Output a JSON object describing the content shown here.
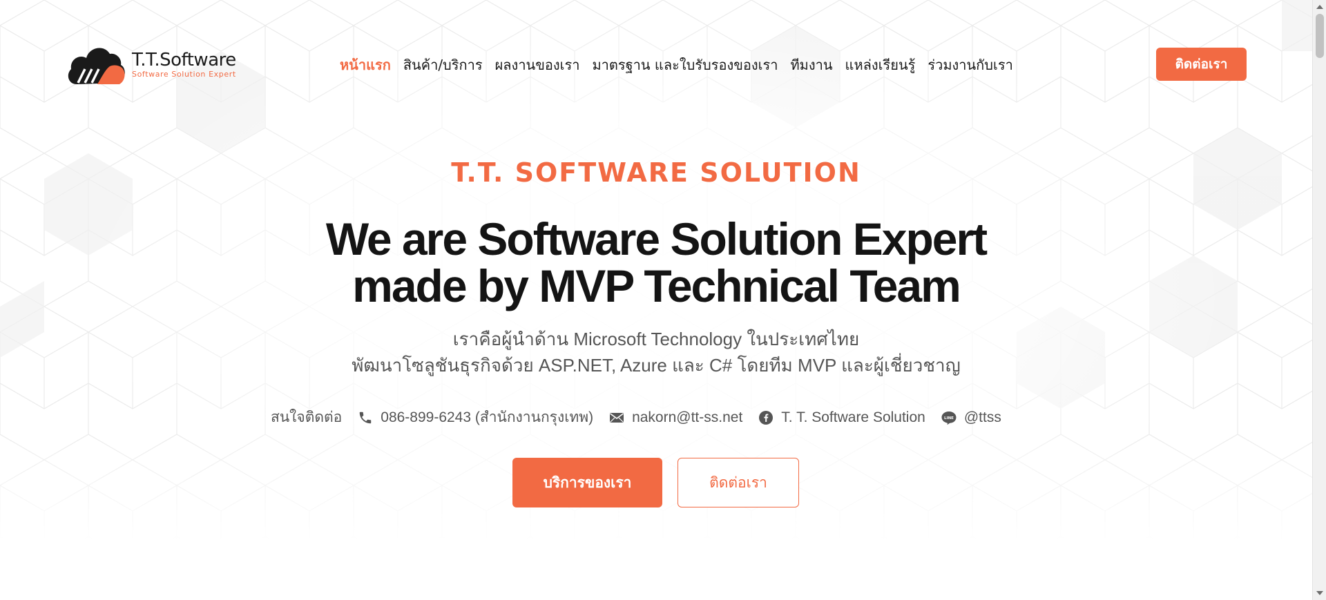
{
  "logo": {
    "name": "T.T.Software",
    "tagline": "Software Solution Expert"
  },
  "nav": {
    "items": [
      {
        "label": "หน้าแรก",
        "active": true
      },
      {
        "label": "สินค้า/บริการ",
        "active": false
      },
      {
        "label": "ผลงานของเรา",
        "active": false
      },
      {
        "label": "มาตรฐาน และใบรับรองของเรา",
        "active": false
      },
      {
        "label": "ทีมงาน",
        "active": false
      },
      {
        "label": "แหล่งเรียนรู้",
        "active": false
      },
      {
        "label": "ร่วมงานกับเรา",
        "active": false
      }
    ],
    "contact_button": "ติดต่อเรา"
  },
  "hero": {
    "eyebrow": "T.T. SOFTWARE SOLUTION",
    "headline_line1": "We are Software Solution Expert",
    "headline_line2": "made by MVP Technical Team",
    "sub_line1": "เราคือผู้นำด้าน Microsoft Technology ในประเทศไทย",
    "sub_line2": "พัฒนาโซลูชันธุรกิจด้วย ASP.NET, Azure และ C# โดยทีม MVP และผู้เชี่ยวชาญ",
    "contacts": {
      "label": "สนใจติดต่อ",
      "phone": "086-899-6243 (สำนักงานกรุงเทพ)",
      "email": "nakorn@tt-ss.net",
      "facebook": "T. T. Software Solution",
      "line": "@ttss"
    },
    "primary_button": "บริการของเรา",
    "secondary_button": "ติดต่อเรา"
  },
  "icons": {
    "phone": "phone-icon",
    "email": "email-icon",
    "facebook": "facebook-icon",
    "line": "line-icon"
  },
  "colors": {
    "accent": "#f26a43",
    "text": "#141414",
    "muted": "#555555"
  }
}
